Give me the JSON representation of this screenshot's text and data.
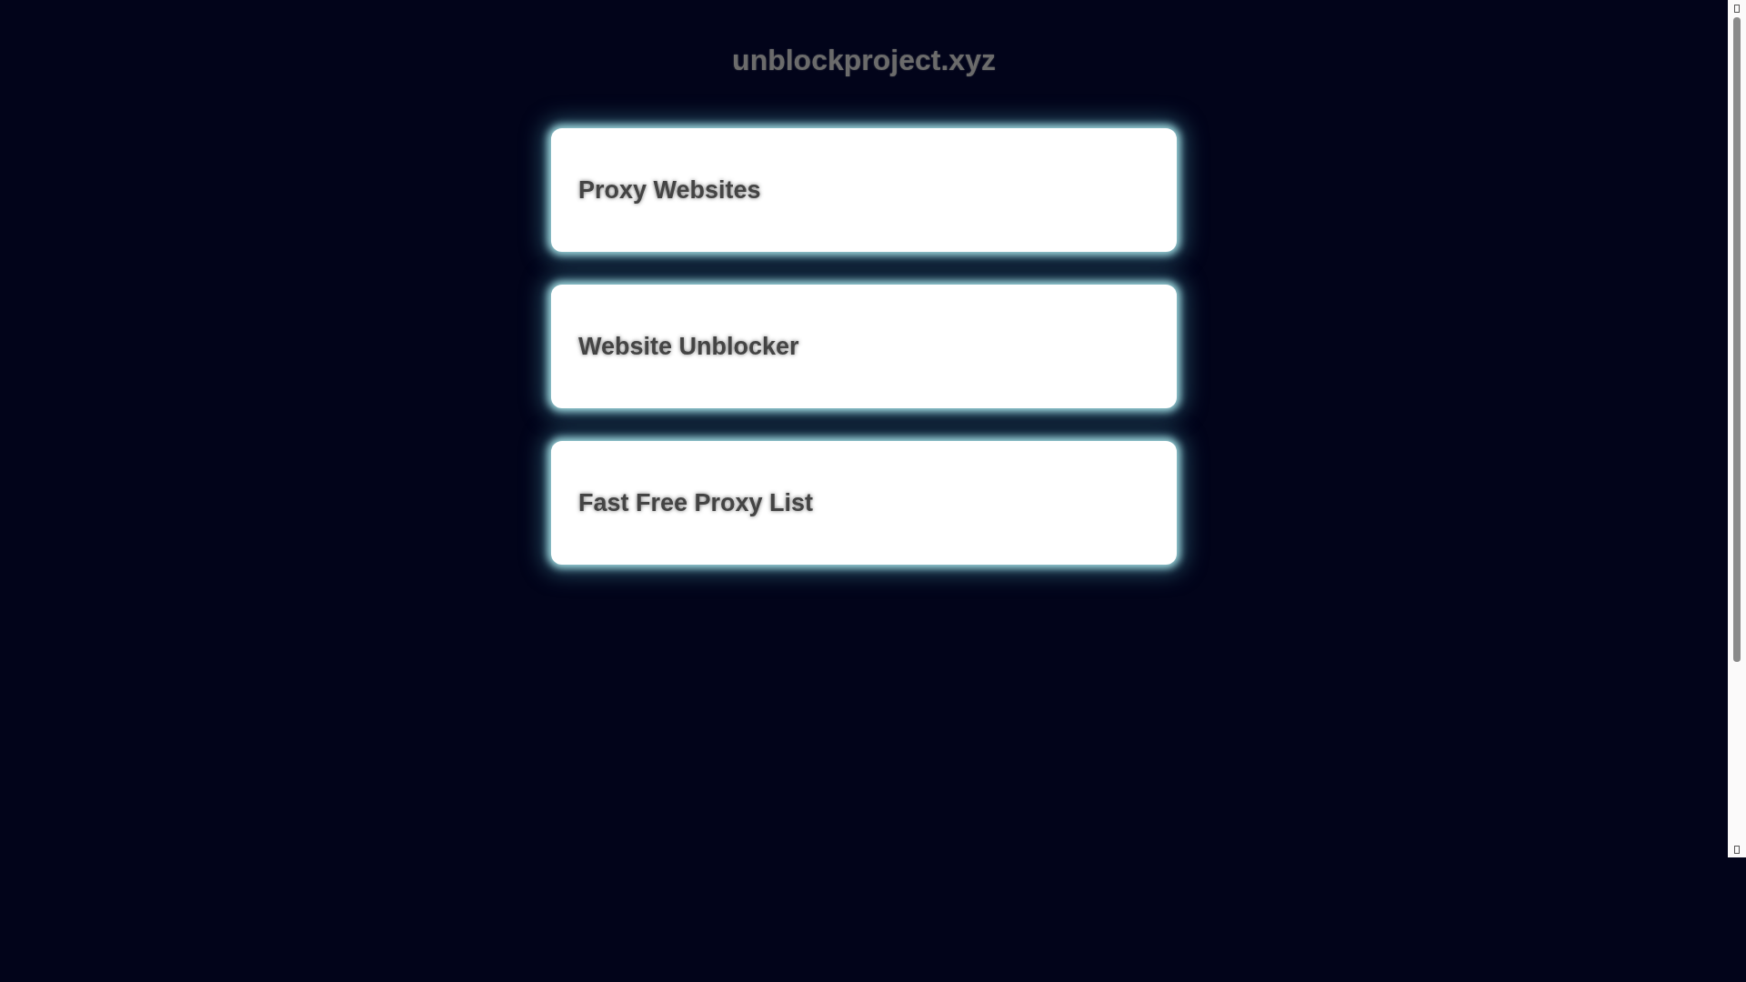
{
  "site_title": "unblockproject.xyz",
  "links": [
    {
      "label": "Proxy Websites"
    },
    {
      "label": "Website Unblocker"
    },
    {
      "label": "Fast Free Proxy List"
    }
  ]
}
